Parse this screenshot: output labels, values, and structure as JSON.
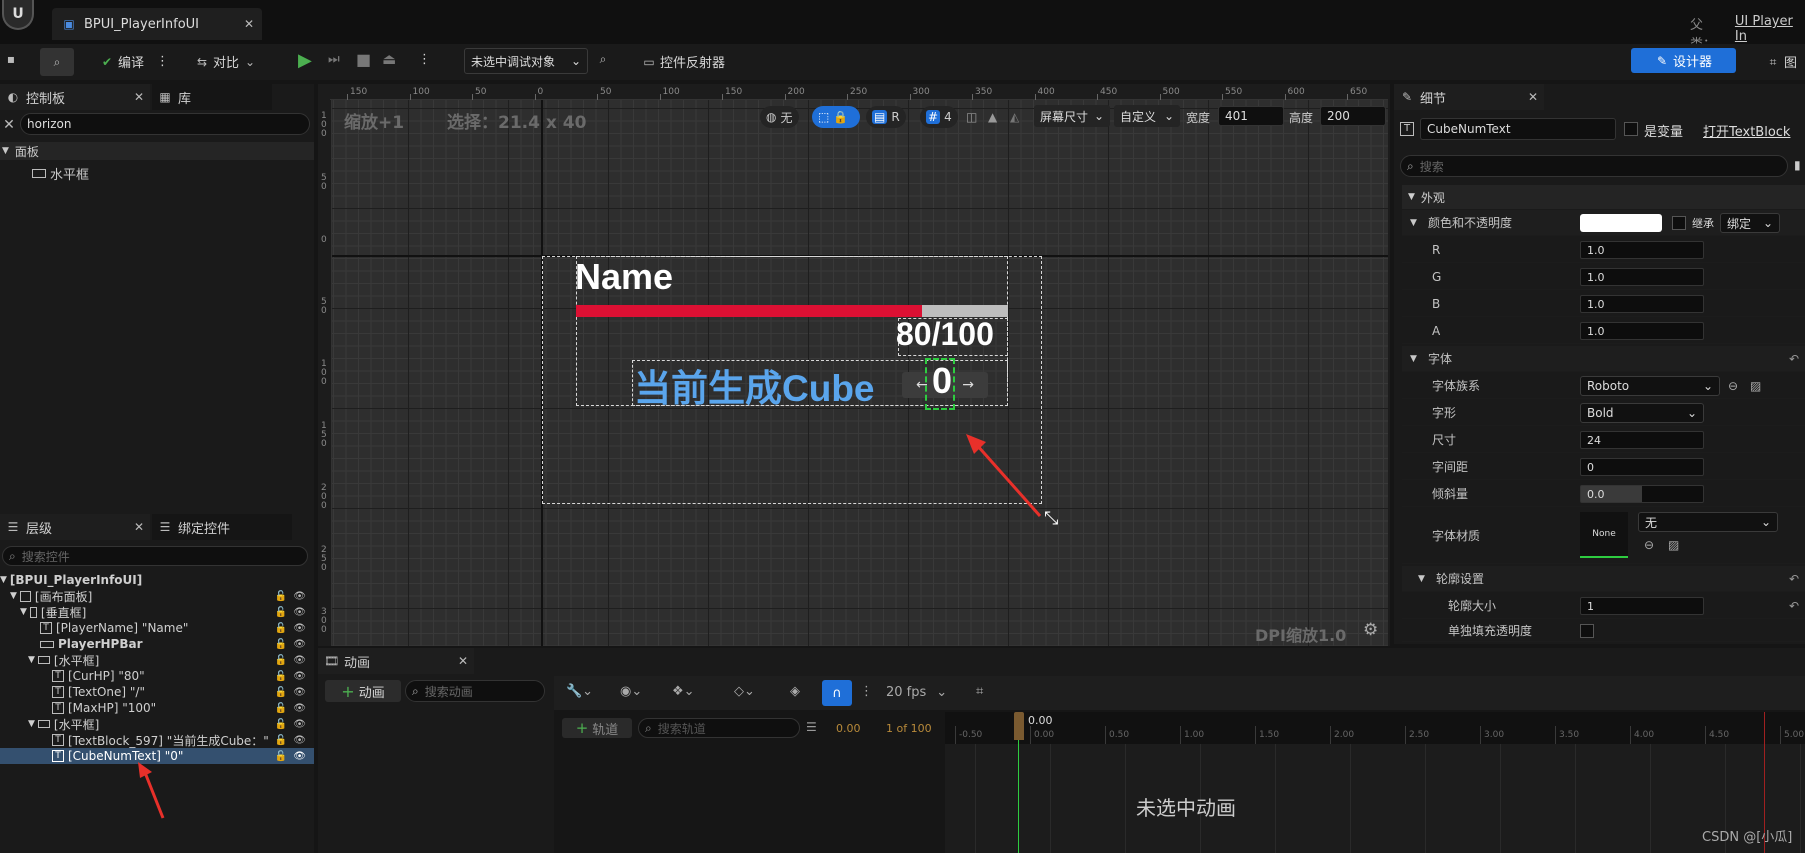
{
  "asset_tab": "BPUI_PlayerInfoUI",
  "parent_label": "父类：",
  "parent_class": "UI Player In",
  "toolbar": {
    "compile": "编译",
    "diff": "对比",
    "debug_target": "未选中调试对象",
    "reflector": "控件反射器",
    "designer": "设计器",
    "graph": "图"
  },
  "palette": {
    "tab": "控制板",
    "library_tab": "库",
    "search_value": "horizon",
    "category": "面板",
    "item": "水平框"
  },
  "hierarchy": {
    "tab": "层级",
    "bind_tab": "绑定控件",
    "search_placeholder": "搜索控件",
    "rows": [
      "[BPUI_PlayerInfoUI]",
      "[画布面板]",
      "[垂直框]",
      "[PlayerName] \"Name\"",
      "PlayerHPBar",
      "[水平框]",
      "[CurHP] \"80\"",
      "[TextOne] \"/\"",
      "[MaxHP] \"100\"",
      "[水平框]",
      "[TextBlock_597] \"当前生成Cube：\"",
      "[CubeNumText] \"0\""
    ]
  },
  "canvas_toolbar": {
    "zoom": "缩放+1",
    "selection": "选择：21.4 x 40",
    "none": "无",
    "r": "R",
    "grid_num": "4",
    "screen_size": "屏幕尺寸",
    "custom": "自定义",
    "width_label": "宽度",
    "width_value": "401",
    "height_label": "高度",
    "height_value": "200",
    "dpi": "DPI缩放1.0"
  },
  "ruler": {
    "h": [
      "150",
      "100",
      "50",
      "0",
      "50",
      "100",
      "150",
      "200",
      "250",
      "300",
      "350",
      "400",
      "450",
      "500",
      "550",
      "600",
      "650"
    ],
    "v": [
      "1\n0\n0",
      "5\n0",
      "0",
      "5\n0",
      "1\n0\n0",
      "1\n5\n0",
      "2\n0\n0",
      "2\n5\n0",
      "3\n0\n0"
    ]
  },
  "widget": {
    "name": "Name",
    "hp_text": "80/100",
    "hp_percent": 80,
    "cube_label": "当前生成Cube",
    "cube_num": "0",
    "arrow_left": "←",
    "arrow_right": "→"
  },
  "details": {
    "tab": "细节",
    "widget_name": "CubeNumText",
    "is_variable": "是变量",
    "open_link": "打开TextBlock",
    "search_placeholder": "搜索",
    "appearance": "外观",
    "color_opacity": "颜色和不透明度",
    "inherit": "继承",
    "bind": "绑定",
    "r_label": "R",
    "r_val": "1.0",
    "g_label": "G",
    "g_val": "1.0",
    "b_label": "B",
    "b_val": "1.0",
    "a_label": "A",
    "a_val": "1.0",
    "font": "字体",
    "font_family": "字体族系",
    "font_family_val": "Roboto",
    "typeface": "字形",
    "typeface_val": "Bold",
    "size": "尺寸",
    "size_val": "24",
    "spacing": "字间距",
    "spacing_val": "0",
    "skew": "倾斜量",
    "skew_val": "0.0",
    "material": "字体材质",
    "material_thumb": "None",
    "material_val": "无",
    "outline": "轮廓设置",
    "outline_size": "轮廓大小",
    "outline_size_val": "1",
    "separate_fill": "单独填充透明度"
  },
  "animation": {
    "tab": "动画",
    "add_button": "动画",
    "search_placeholder": "搜索动画",
    "fps": "20 fps",
    "track_button": "轨道",
    "track_search": "搜索轨道",
    "time": "0.00",
    "frame": "1 of 100",
    "marker": "0.00",
    "timeline_ticks": [
      "-0.50",
      "0.00",
      "0.50",
      "1.00",
      "1.50",
      "2.00",
      "2.50",
      "3.00",
      "3.50",
      "4.00",
      "4.50",
      "5.00"
    ],
    "empty": "未选中动画"
  },
  "watermark": "CSDN @[小瓜]",
  "colors": {
    "hp_fill": "#dc1033",
    "hp_back": "#bdbdbd",
    "cube_text": "#5aa5ec",
    "accent": "#1f6fd8"
  }
}
